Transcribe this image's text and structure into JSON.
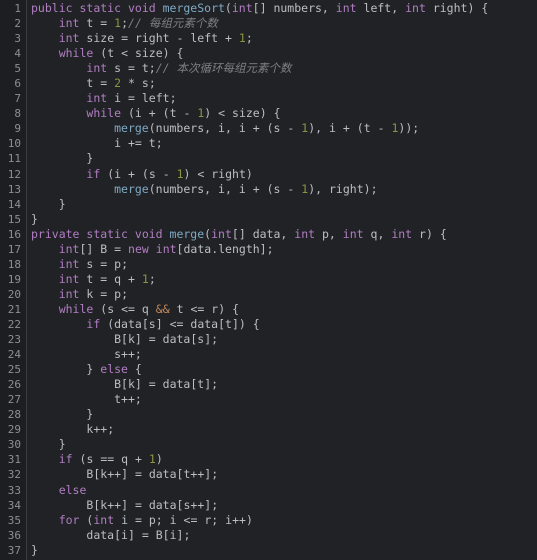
{
  "editor": {
    "theme_name": "dark",
    "language": "java",
    "colors": {
      "background": "#212226",
      "gutter_background": "#1d1e21",
      "gutter_border": "#3b3d42",
      "line_number": "#8d8f93",
      "default_text": "#bcbec4",
      "keyword": "#b07ec2",
      "number": "#8c9440",
      "comment": "#7d8085",
      "function": "#7fa9c4",
      "operator": "#c38a5a"
    },
    "total_lines": 37,
    "first_visible_line": 1,
    "last_visible_line": 37,
    "line_numbers": [
      "1",
      "2",
      "3",
      "4",
      "5",
      "6",
      "7",
      "8",
      "9",
      "10",
      "11",
      "12",
      "13",
      "14",
      "15",
      "16",
      "17",
      "18",
      "19",
      "20",
      "21",
      "22",
      "23",
      "24",
      "25",
      "26",
      "27",
      "28",
      "29",
      "30",
      "31",
      "32",
      "33",
      "34",
      "35",
      "36",
      "37"
    ],
    "lines": [
      {
        "n": "1",
        "text": "public static void mergeSort(int[] numbers, int left, int right) {"
      },
      {
        "n": "2",
        "text": "    int t = 1;// 每组元素个数"
      },
      {
        "n": "3",
        "text": "    int size = right - left + 1;"
      },
      {
        "n": "4",
        "text": "    while (t < size) {"
      },
      {
        "n": "5",
        "text": "        int s = t;// 本次循环每组元素个数"
      },
      {
        "n": "6",
        "text": "        t = 2 * s;"
      },
      {
        "n": "7",
        "text": "        int i = left;"
      },
      {
        "n": "8",
        "text": "        while (i + (t - 1) < size) {"
      },
      {
        "n": "9",
        "text": "            merge(numbers, i, i + (s - 1), i + (t - 1));"
      },
      {
        "n": "10",
        "text": "            i += t;"
      },
      {
        "n": "11",
        "text": "        }"
      },
      {
        "n": "12",
        "text": "        if (i + (s - 1) < right)"
      },
      {
        "n": "13",
        "text": "            merge(numbers, i, i + (s - 1), right);"
      },
      {
        "n": "14",
        "text": "    }"
      },
      {
        "n": "15",
        "text": "}"
      },
      {
        "n": "16",
        "text": "private static void merge(int[] data, int p, int q, int r) {"
      },
      {
        "n": "17",
        "text": "    int[] B = new int[data.length];"
      },
      {
        "n": "18",
        "text": "    int s = p;"
      },
      {
        "n": "19",
        "text": "    int t = q + 1;"
      },
      {
        "n": "20",
        "text": "    int k = p;"
      },
      {
        "n": "21",
        "text": "    while (s <= q && t <= r) {"
      },
      {
        "n": "22",
        "text": "        if (data[s] <= data[t]) {"
      },
      {
        "n": "23",
        "text": "            B[k] = data[s];"
      },
      {
        "n": "24",
        "text": "            s++;"
      },
      {
        "n": "25",
        "text": "        } else {"
      },
      {
        "n": "26",
        "text": "            B[k] = data[t];"
      },
      {
        "n": "27",
        "text": "            t++;"
      },
      {
        "n": "28",
        "text": "        }"
      },
      {
        "n": "29",
        "text": "        k++;"
      },
      {
        "n": "30",
        "text": "    }"
      },
      {
        "n": "31",
        "text": "    if (s == q + 1)"
      },
      {
        "n": "32",
        "text": "        B[k++] = data[t++];"
      },
      {
        "n": "33",
        "text": "    else"
      },
      {
        "n": "34",
        "text": "        B[k++] = data[s++];"
      },
      {
        "n": "35",
        "text": "    for (int i = p; i <= r; i++)"
      },
      {
        "n": "36",
        "text": "        data[i] = B[i];"
      },
      {
        "n": "37",
        "text": "}"
      }
    ],
    "comments": [
      {
        "line": "2",
        "text": "// 每组元素个数"
      },
      {
        "line": "5",
        "text": "// 本次循环每组元素个数"
      }
    ],
    "methods": [
      "mergeSort",
      "merge"
    ],
    "keywords_used": [
      "public",
      "private",
      "static",
      "void",
      "int",
      "while",
      "if",
      "else",
      "for",
      "new"
    ]
  }
}
